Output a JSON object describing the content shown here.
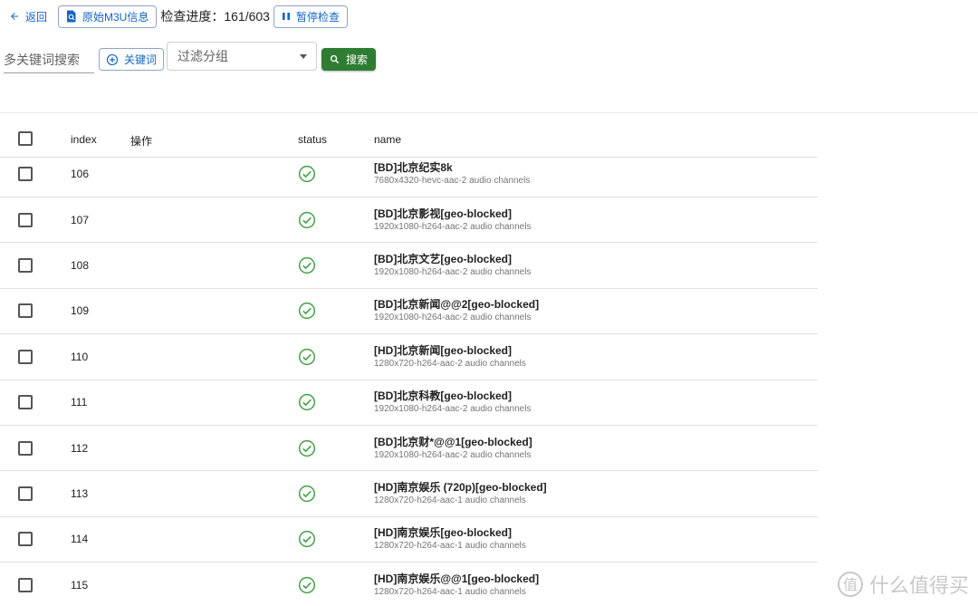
{
  "toolbar": {
    "back_label": "返回",
    "m3u_label": "原始M3U信息",
    "progress_label": "检查进度：161/603",
    "pause_label": "暂停检查"
  },
  "filters": {
    "keyword_placeholder": "多关键词搜索",
    "add_keyword_label": "关键词",
    "group_placeholder": "过滤分组",
    "search_label": "搜索"
  },
  "table": {
    "headers": {
      "index": "index",
      "action": "操作",
      "status": "status",
      "name": "name"
    },
    "rows": [
      {
        "index": "106",
        "name": "[BD]北京纪实8k",
        "detail": "7680x4320-hevc-aac-2 audio channels",
        "status": "ok"
      },
      {
        "index": "107",
        "name": "[BD]北京影视[geo-blocked]",
        "detail": "1920x1080-h264-aac-2 audio channels",
        "status": "ok"
      },
      {
        "index": "108",
        "name": "[BD]北京文艺[geo-blocked]",
        "detail": "1920x1080-h264-aac-2 audio channels",
        "status": "ok"
      },
      {
        "index": "109",
        "name": "[BD]北京新闻@@2[geo-blocked]",
        "detail": "1920x1080-h264-aac-2 audio channels",
        "status": "ok"
      },
      {
        "index": "110",
        "name": "[HD]北京新闻[geo-blocked]",
        "detail": "1280x720-h264-aac-2 audio channels",
        "status": "ok"
      },
      {
        "index": "111",
        "name": "[BD]北京科教[geo-blocked]",
        "detail": "1920x1080-h264-aac-2 audio channels",
        "status": "ok"
      },
      {
        "index": "112",
        "name": "[BD]北京财*@@1[geo-blocked]",
        "detail": "1920x1080-h264-aac-2 audio channels",
        "status": "ok"
      },
      {
        "index": "113",
        "name": "[HD]南京娱乐 (720p)[geo-blocked]",
        "detail": "1280x720-h264-aac-1 audio channels",
        "status": "ok"
      },
      {
        "index": "114",
        "name": "[HD]南京娱乐[geo-blocked]",
        "detail": "1280x720-h264-aac-1 audio channels",
        "status": "ok"
      },
      {
        "index": "115",
        "name": "[HD]南京娱乐@@1[geo-blocked]",
        "detail": "1280x720-h264-aac-1 audio channels",
        "status": "ok"
      }
    ]
  },
  "watermark": {
    "text": "什么值得买",
    "icon": "smzdm-logo-icon"
  },
  "colors": {
    "primary": "#1565c0",
    "success": "#2e7d32",
    "status_ok": "#43a047"
  },
  "icons": {
    "back": "arrow-left-icon",
    "m3u": "search-document-icon",
    "pause": "pause-icon",
    "add": "plus-circle-icon",
    "search": "magnifier-icon",
    "status_ok": "check-circle-icon"
  }
}
